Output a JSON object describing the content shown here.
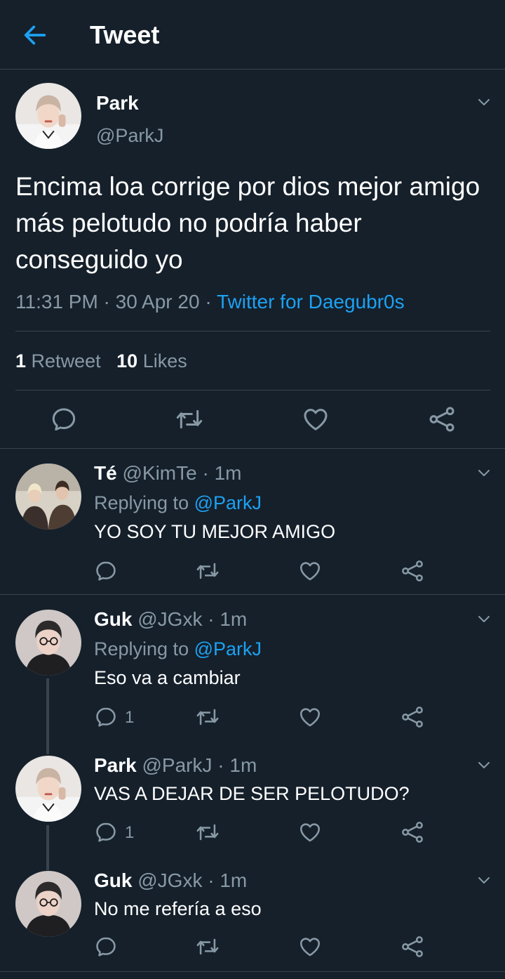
{
  "header": {
    "title": "Tweet"
  },
  "main_tweet": {
    "name": "Park",
    "handle": "@ParkJ",
    "text": "Encima loa corrige por dios mejor amigo más pelotudo no podría haber conseguido yo",
    "time": "11:31 PM",
    "dot1": " · ",
    "date": "30 Apr 20",
    "dot2": " · ",
    "source": "Twitter for Daegubr0s",
    "retweet_count": "1",
    "retweet_label": "Retweet",
    "like_count": "10",
    "like_label": "Likes"
  },
  "replies": [
    {
      "name": "Té",
      "handle": "@KimTe",
      "time": "· 1m",
      "replying_label": "Replying to",
      "replying_to": "@ParkJ",
      "text": "YO SOY TU MEJOR AMIGO",
      "reply_count": ""
    },
    {
      "name": "Guk",
      "handle": "@JGxk",
      "time": "· 1m",
      "replying_label": "Replying to",
      "replying_to": "@ParkJ",
      "text": "Eso va a cambiar",
      "reply_count": "1"
    },
    {
      "name": "Park",
      "handle": "@ParkJ",
      "time": "· 1m",
      "text": "VAS A DEJAR DE SER PELOTUDO?",
      "reply_count": "1"
    },
    {
      "name": "Guk",
      "handle": "@JGxk",
      "time": "· 1m",
      "text": "No me refería a eso",
      "reply_count": ""
    }
  ],
  "colors": {
    "background": "#15202b",
    "divider": "#38444d",
    "muted": "#8899a6",
    "accent": "#1da1f2"
  },
  "icons": [
    "back-arrow-icon",
    "chevron-down-icon",
    "reply-icon",
    "retweet-icon",
    "like-icon",
    "share-icon"
  ]
}
